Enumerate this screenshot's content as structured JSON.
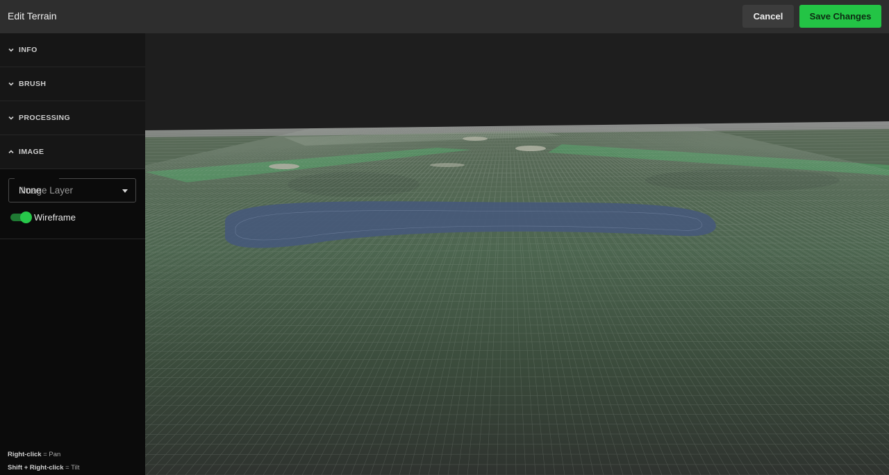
{
  "header": {
    "title": "Edit Terrain",
    "cancel_label": "Cancel",
    "save_label": "Save Changes"
  },
  "sidebar": {
    "sections": [
      {
        "label": "INFO",
        "expanded": false
      },
      {
        "label": "BRUSH",
        "expanded": false
      },
      {
        "label": "PROCESSING",
        "expanded": false
      },
      {
        "label": "IMAGE",
        "expanded": true
      }
    ],
    "image": {
      "layer_placeholder": "Image Layer",
      "layer_value": "None",
      "wireframe_label": "Wireframe",
      "wireframe_on": true
    },
    "hints": [
      {
        "key": "Right-click",
        "action": "Pan"
      },
      {
        "key": "Shift + Right-click",
        "action": "Tilt"
      }
    ]
  },
  "colors": {
    "accent": "#23c445",
    "terrain_green": "#4a7a55",
    "water": "#3d4f6e",
    "sky": "#1e1e1e"
  }
}
